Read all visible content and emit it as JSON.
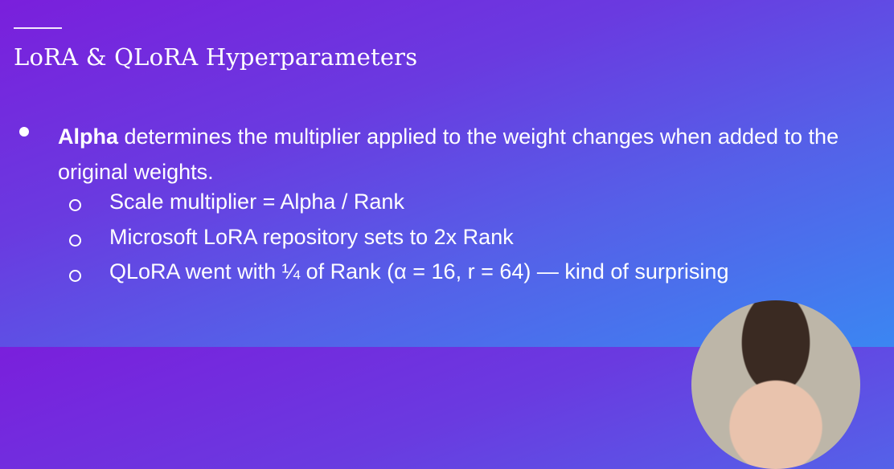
{
  "slide": {
    "title": "LoRA & QLoRA Hyperparameters",
    "bullet": {
      "bold": "Alpha",
      "text": " determines the multiplier applied to the weight changes when added to the original weights."
    },
    "sub_bullets": [
      "Scale multiplier = Alpha / Rank",
      "Microsoft LoRA repository sets to 2x Rank",
      "QLoRA went with ¼ of Rank (α = 16, r = 64) — kind of surprising"
    ]
  }
}
